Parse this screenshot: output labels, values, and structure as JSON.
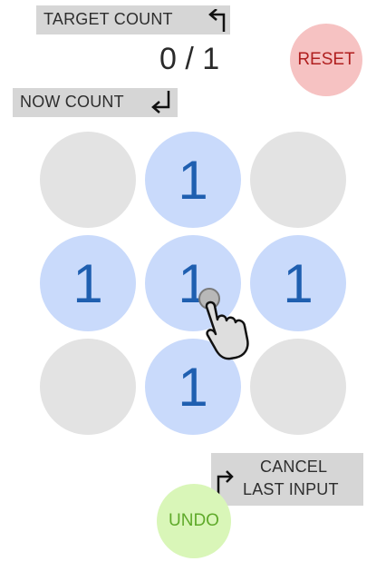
{
  "labels": {
    "target_count": "TARGET COUNT",
    "now_count": "NOW COUNT",
    "cancel_line1": "CANCEL",
    "cancel_line2": "LAST INPUT"
  },
  "counter": {
    "now": "0",
    "separator": " / ",
    "target": "1"
  },
  "buttons": {
    "reset": "RESET",
    "undo": "UNDO"
  },
  "grid": [
    {
      "value": "",
      "active": false
    },
    {
      "value": "1",
      "active": true
    },
    {
      "value": "",
      "active": false
    },
    {
      "value": "1",
      "active": true
    },
    {
      "value": "1",
      "active": true
    },
    {
      "value": "1",
      "active": true
    },
    {
      "value": "",
      "active": false
    },
    {
      "value": "1",
      "active": true
    },
    {
      "value": "",
      "active": false
    }
  ],
  "colors": {
    "active_cell": "#c9dafb",
    "inactive_cell": "#e3e3e3",
    "digit": "#1f5fb0",
    "reset_bg": "#f6c2c2",
    "reset_text": "#b01f1f",
    "undo_bg": "#d9f6b8",
    "undo_text": "#5faa2a"
  },
  "icons": {
    "tap_hint": "pointing-hand-icon"
  }
}
